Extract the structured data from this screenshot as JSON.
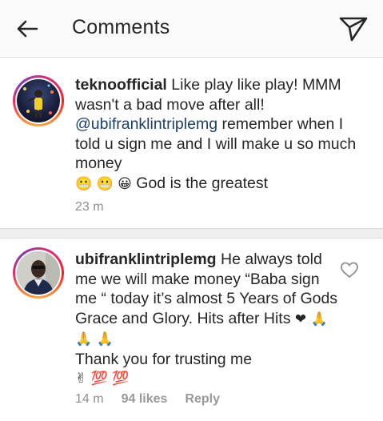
{
  "header": {
    "title": "Comments"
  },
  "comments": [
    {
      "username": "teknoofficial",
      "text_1": " Like play like play! MMM wasn't a bad move after all! ",
      "mention": "@ubifranklintriplemg",
      "text_2": " remember when I told u sign me and I will make u so much money",
      "emojis": "😬 😬 😀",
      "text_3": "  God is the greatest",
      "time": "23 m"
    },
    {
      "username": "ubifranklintriplemg",
      "text_1": " He always told me we will make money “Baba sign me “ today it’s almost 5 Years of Gods Grace and Glory. Hits after Hits ",
      "heart_emoji": "❤",
      "emojis_1": "  🙏 🙏 🙏",
      "text_2": "Thank you for trusting me",
      "emojis_2": "✌ 💯 💯",
      "time": "14 m",
      "likes": "94 likes",
      "reply": "Reply"
    }
  ]
}
